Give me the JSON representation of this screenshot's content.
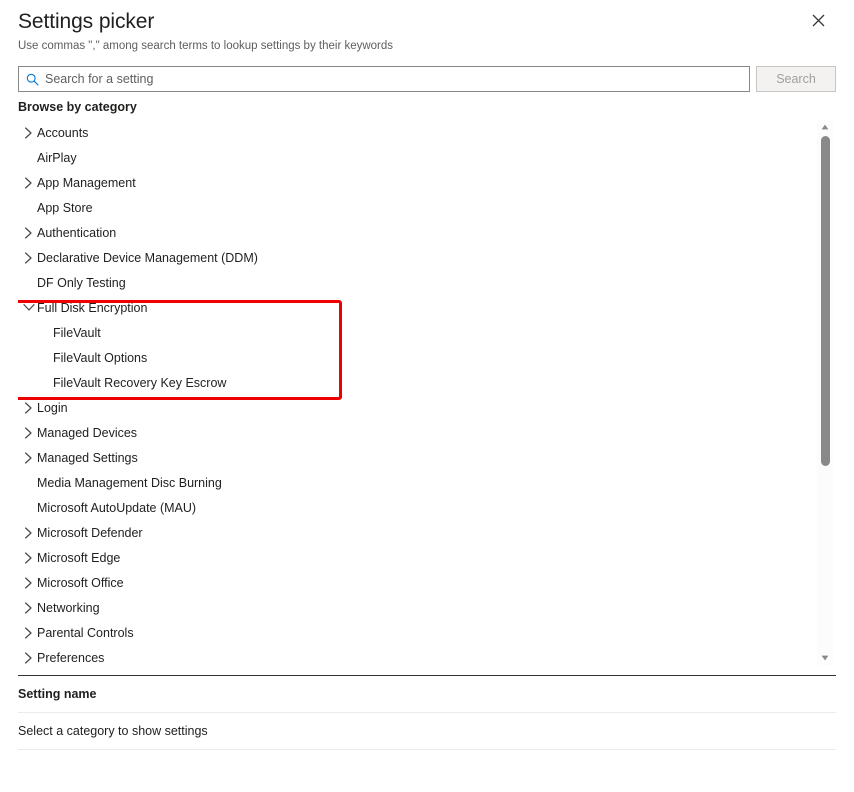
{
  "dialog": {
    "title": "Settings picker",
    "subtitle": "Use commas \",\" among search terms to lookup settings by their keywords",
    "close_icon": "close-icon"
  },
  "search": {
    "icon": "search-icon",
    "value": "",
    "placeholder": "Search for a setting",
    "button_label": "Search",
    "button_enabled": false
  },
  "browse": {
    "label": "Browse by category"
  },
  "categories": [
    {
      "label": "Accounts",
      "expandable": true,
      "expanded": false,
      "level": 0
    },
    {
      "label": "AirPlay",
      "expandable": false,
      "expanded": false,
      "level": 0
    },
    {
      "label": "App Management",
      "expandable": true,
      "expanded": false,
      "level": 0
    },
    {
      "label": "App Store",
      "expandable": false,
      "expanded": false,
      "level": 0
    },
    {
      "label": "Authentication",
      "expandable": true,
      "expanded": false,
      "level": 0
    },
    {
      "label": "Declarative Device Management (DDM)",
      "expandable": true,
      "expanded": false,
      "level": 0
    },
    {
      "label": "DF Only Testing",
      "expandable": false,
      "expanded": false,
      "level": 0
    },
    {
      "label": "Full Disk Encryption",
      "expandable": true,
      "expanded": true,
      "level": 0
    },
    {
      "label": "FileVault",
      "expandable": false,
      "expanded": false,
      "level": 1
    },
    {
      "label": "FileVault Options",
      "expandable": false,
      "expanded": false,
      "level": 1
    },
    {
      "label": "FileVault Recovery Key Escrow",
      "expandable": false,
      "expanded": false,
      "level": 1
    },
    {
      "label": "Login",
      "expandable": true,
      "expanded": false,
      "level": 0
    },
    {
      "label": "Managed Devices",
      "expandable": true,
      "expanded": false,
      "level": 0
    },
    {
      "label": "Managed Settings",
      "expandable": true,
      "expanded": false,
      "level": 0
    },
    {
      "label": "Media Management Disc Burning",
      "expandable": false,
      "expanded": false,
      "level": 0
    },
    {
      "label": "Microsoft AutoUpdate (MAU)",
      "expandable": false,
      "expanded": false,
      "level": 0
    },
    {
      "label": "Microsoft Defender",
      "expandable": true,
      "expanded": false,
      "level": 0
    },
    {
      "label": "Microsoft Edge",
      "expandable": true,
      "expanded": false,
      "level": 0
    },
    {
      "label": "Microsoft Office",
      "expandable": true,
      "expanded": false,
      "level": 0
    },
    {
      "label": "Networking",
      "expandable": true,
      "expanded": false,
      "level": 0
    },
    {
      "label": "Parental Controls",
      "expandable": true,
      "expanded": false,
      "level": 0
    },
    {
      "label": "Preferences",
      "expandable": true,
      "expanded": false,
      "level": 0
    }
  ],
  "annotation": {
    "highlight_color": "#ee0000",
    "highlights_category": "Full Disk Encryption"
  },
  "scrollbar": {
    "up_icon": "scroll-up-arrow-icon",
    "down_icon": "scroll-down-arrow-icon"
  },
  "detail": {
    "column_header": "Setting name",
    "empty_message": "Select a category to show settings"
  }
}
